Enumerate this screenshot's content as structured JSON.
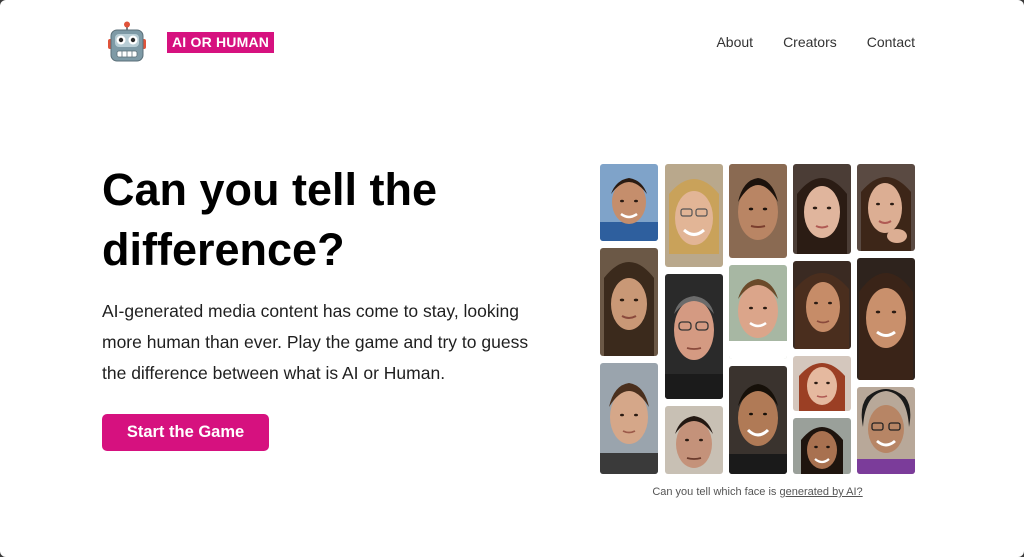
{
  "header": {
    "brand_label": "AI OR HUMAN",
    "logo_icon": "robot-icon",
    "nav": {
      "about": "About",
      "creators": "Creators",
      "contact": "Contact"
    }
  },
  "hero": {
    "headline": "Can you tell the difference?",
    "lead": "AI-generated media content has come to stay, looking more human than ever. Play the game and try to guess the difference between what is AI or Human.",
    "cta_label": "Start the Game"
  },
  "gallery": {
    "caption_text": "Can you tell which face is ",
    "caption_link": "generated by AI?"
  },
  "colors": {
    "accent": "#d6117f",
    "text": "#000000",
    "nav_text": "#333333"
  }
}
